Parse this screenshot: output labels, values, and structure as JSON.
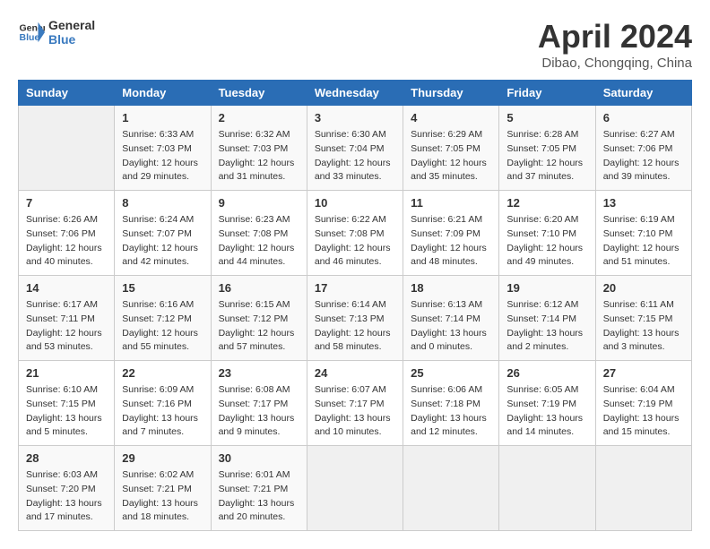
{
  "logo": {
    "line1": "General",
    "line2": "Blue"
  },
  "title": "April 2024",
  "location": "Dibao, Chongqing, China",
  "days_of_week": [
    "Sunday",
    "Monday",
    "Tuesday",
    "Wednesday",
    "Thursday",
    "Friday",
    "Saturday"
  ],
  "weeks": [
    [
      {
        "num": "",
        "sunrise": "",
        "sunset": "",
        "daylight": ""
      },
      {
        "num": "1",
        "sunrise": "Sunrise: 6:33 AM",
        "sunset": "Sunset: 7:03 PM",
        "daylight": "Daylight: 12 hours and 29 minutes."
      },
      {
        "num": "2",
        "sunrise": "Sunrise: 6:32 AM",
        "sunset": "Sunset: 7:03 PM",
        "daylight": "Daylight: 12 hours and 31 minutes."
      },
      {
        "num": "3",
        "sunrise": "Sunrise: 6:30 AM",
        "sunset": "Sunset: 7:04 PM",
        "daylight": "Daylight: 12 hours and 33 minutes."
      },
      {
        "num": "4",
        "sunrise": "Sunrise: 6:29 AM",
        "sunset": "Sunset: 7:05 PM",
        "daylight": "Daylight: 12 hours and 35 minutes."
      },
      {
        "num": "5",
        "sunrise": "Sunrise: 6:28 AM",
        "sunset": "Sunset: 7:05 PM",
        "daylight": "Daylight: 12 hours and 37 minutes."
      },
      {
        "num": "6",
        "sunrise": "Sunrise: 6:27 AM",
        "sunset": "Sunset: 7:06 PM",
        "daylight": "Daylight: 12 hours and 39 minutes."
      }
    ],
    [
      {
        "num": "7",
        "sunrise": "Sunrise: 6:26 AM",
        "sunset": "Sunset: 7:06 PM",
        "daylight": "Daylight: 12 hours and 40 minutes."
      },
      {
        "num": "8",
        "sunrise": "Sunrise: 6:24 AM",
        "sunset": "Sunset: 7:07 PM",
        "daylight": "Daylight: 12 hours and 42 minutes."
      },
      {
        "num": "9",
        "sunrise": "Sunrise: 6:23 AM",
        "sunset": "Sunset: 7:08 PM",
        "daylight": "Daylight: 12 hours and 44 minutes."
      },
      {
        "num": "10",
        "sunrise": "Sunrise: 6:22 AM",
        "sunset": "Sunset: 7:08 PM",
        "daylight": "Daylight: 12 hours and 46 minutes."
      },
      {
        "num": "11",
        "sunrise": "Sunrise: 6:21 AM",
        "sunset": "Sunset: 7:09 PM",
        "daylight": "Daylight: 12 hours and 48 minutes."
      },
      {
        "num": "12",
        "sunrise": "Sunrise: 6:20 AM",
        "sunset": "Sunset: 7:10 PM",
        "daylight": "Daylight: 12 hours and 49 minutes."
      },
      {
        "num": "13",
        "sunrise": "Sunrise: 6:19 AM",
        "sunset": "Sunset: 7:10 PM",
        "daylight": "Daylight: 12 hours and 51 minutes."
      }
    ],
    [
      {
        "num": "14",
        "sunrise": "Sunrise: 6:17 AM",
        "sunset": "Sunset: 7:11 PM",
        "daylight": "Daylight: 12 hours and 53 minutes."
      },
      {
        "num": "15",
        "sunrise": "Sunrise: 6:16 AM",
        "sunset": "Sunset: 7:12 PM",
        "daylight": "Daylight: 12 hours and 55 minutes."
      },
      {
        "num": "16",
        "sunrise": "Sunrise: 6:15 AM",
        "sunset": "Sunset: 7:12 PM",
        "daylight": "Daylight: 12 hours and 57 minutes."
      },
      {
        "num": "17",
        "sunrise": "Sunrise: 6:14 AM",
        "sunset": "Sunset: 7:13 PM",
        "daylight": "Daylight: 12 hours and 58 minutes."
      },
      {
        "num": "18",
        "sunrise": "Sunrise: 6:13 AM",
        "sunset": "Sunset: 7:14 PM",
        "daylight": "Daylight: 13 hours and 0 minutes."
      },
      {
        "num": "19",
        "sunrise": "Sunrise: 6:12 AM",
        "sunset": "Sunset: 7:14 PM",
        "daylight": "Daylight: 13 hours and 2 minutes."
      },
      {
        "num": "20",
        "sunrise": "Sunrise: 6:11 AM",
        "sunset": "Sunset: 7:15 PM",
        "daylight": "Daylight: 13 hours and 3 minutes."
      }
    ],
    [
      {
        "num": "21",
        "sunrise": "Sunrise: 6:10 AM",
        "sunset": "Sunset: 7:15 PM",
        "daylight": "Daylight: 13 hours and 5 minutes."
      },
      {
        "num": "22",
        "sunrise": "Sunrise: 6:09 AM",
        "sunset": "Sunset: 7:16 PM",
        "daylight": "Daylight: 13 hours and 7 minutes."
      },
      {
        "num": "23",
        "sunrise": "Sunrise: 6:08 AM",
        "sunset": "Sunset: 7:17 PM",
        "daylight": "Daylight: 13 hours and 9 minutes."
      },
      {
        "num": "24",
        "sunrise": "Sunrise: 6:07 AM",
        "sunset": "Sunset: 7:17 PM",
        "daylight": "Daylight: 13 hours and 10 minutes."
      },
      {
        "num": "25",
        "sunrise": "Sunrise: 6:06 AM",
        "sunset": "Sunset: 7:18 PM",
        "daylight": "Daylight: 13 hours and 12 minutes."
      },
      {
        "num": "26",
        "sunrise": "Sunrise: 6:05 AM",
        "sunset": "Sunset: 7:19 PM",
        "daylight": "Daylight: 13 hours and 14 minutes."
      },
      {
        "num": "27",
        "sunrise": "Sunrise: 6:04 AM",
        "sunset": "Sunset: 7:19 PM",
        "daylight": "Daylight: 13 hours and 15 minutes."
      }
    ],
    [
      {
        "num": "28",
        "sunrise": "Sunrise: 6:03 AM",
        "sunset": "Sunset: 7:20 PM",
        "daylight": "Daylight: 13 hours and 17 minutes."
      },
      {
        "num": "29",
        "sunrise": "Sunrise: 6:02 AM",
        "sunset": "Sunset: 7:21 PM",
        "daylight": "Daylight: 13 hours and 18 minutes."
      },
      {
        "num": "30",
        "sunrise": "Sunrise: 6:01 AM",
        "sunset": "Sunset: 7:21 PM",
        "daylight": "Daylight: 13 hours and 20 minutes."
      },
      {
        "num": "",
        "sunrise": "",
        "sunset": "",
        "daylight": ""
      },
      {
        "num": "",
        "sunrise": "",
        "sunset": "",
        "daylight": ""
      },
      {
        "num": "",
        "sunrise": "",
        "sunset": "",
        "daylight": ""
      },
      {
        "num": "",
        "sunrise": "",
        "sunset": "",
        "daylight": ""
      }
    ]
  ]
}
